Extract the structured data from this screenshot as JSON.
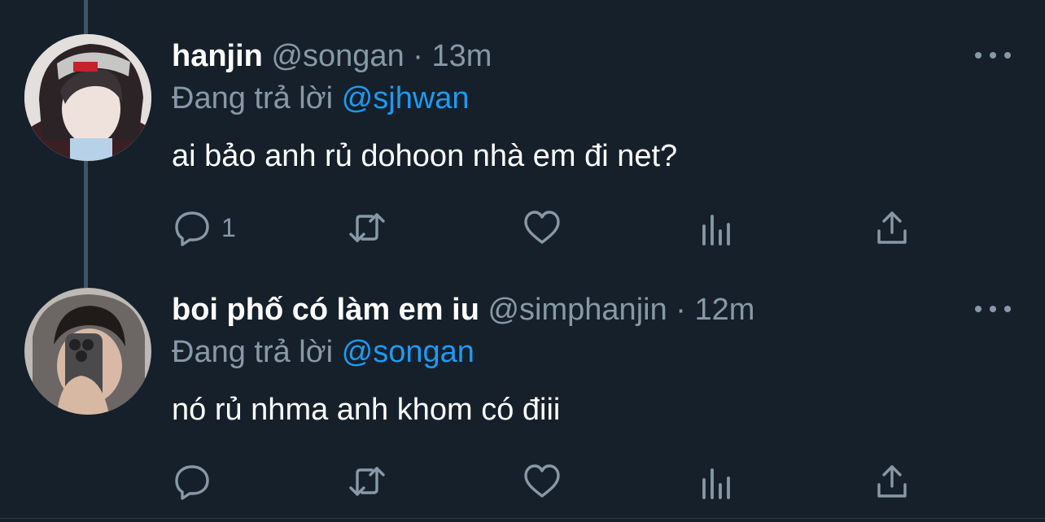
{
  "colors": {
    "background": "#15202b",
    "secondary_text": "#8899a6",
    "link": "#1d9bf0",
    "thread_line": "#3d5466"
  },
  "tweets": [
    {
      "display_name": "hanjin",
      "handle": "@songan",
      "separator": "·",
      "time": "13m",
      "reply_prefix": "Đang trả lời",
      "reply_handle": "@sjhwan",
      "text": "ai bảo anh rủ dohoon nhà em đi net?",
      "reply_count": "1",
      "icons": [
        "reply-icon",
        "retweet-icon",
        "like-icon",
        "views-icon",
        "share-icon",
        "more-icon"
      ]
    },
    {
      "display_name": "boi phố có làm em iu",
      "handle": "@simphanjin",
      "separator": "·",
      "time": "12m",
      "reply_prefix": "Đang trả lời",
      "reply_handle": "@songan",
      "text": "nó rủ nhma anh khom có điii",
      "reply_count": "",
      "icons": [
        "reply-icon",
        "retweet-icon",
        "like-icon",
        "views-icon",
        "share-icon",
        "more-icon"
      ]
    }
  ]
}
